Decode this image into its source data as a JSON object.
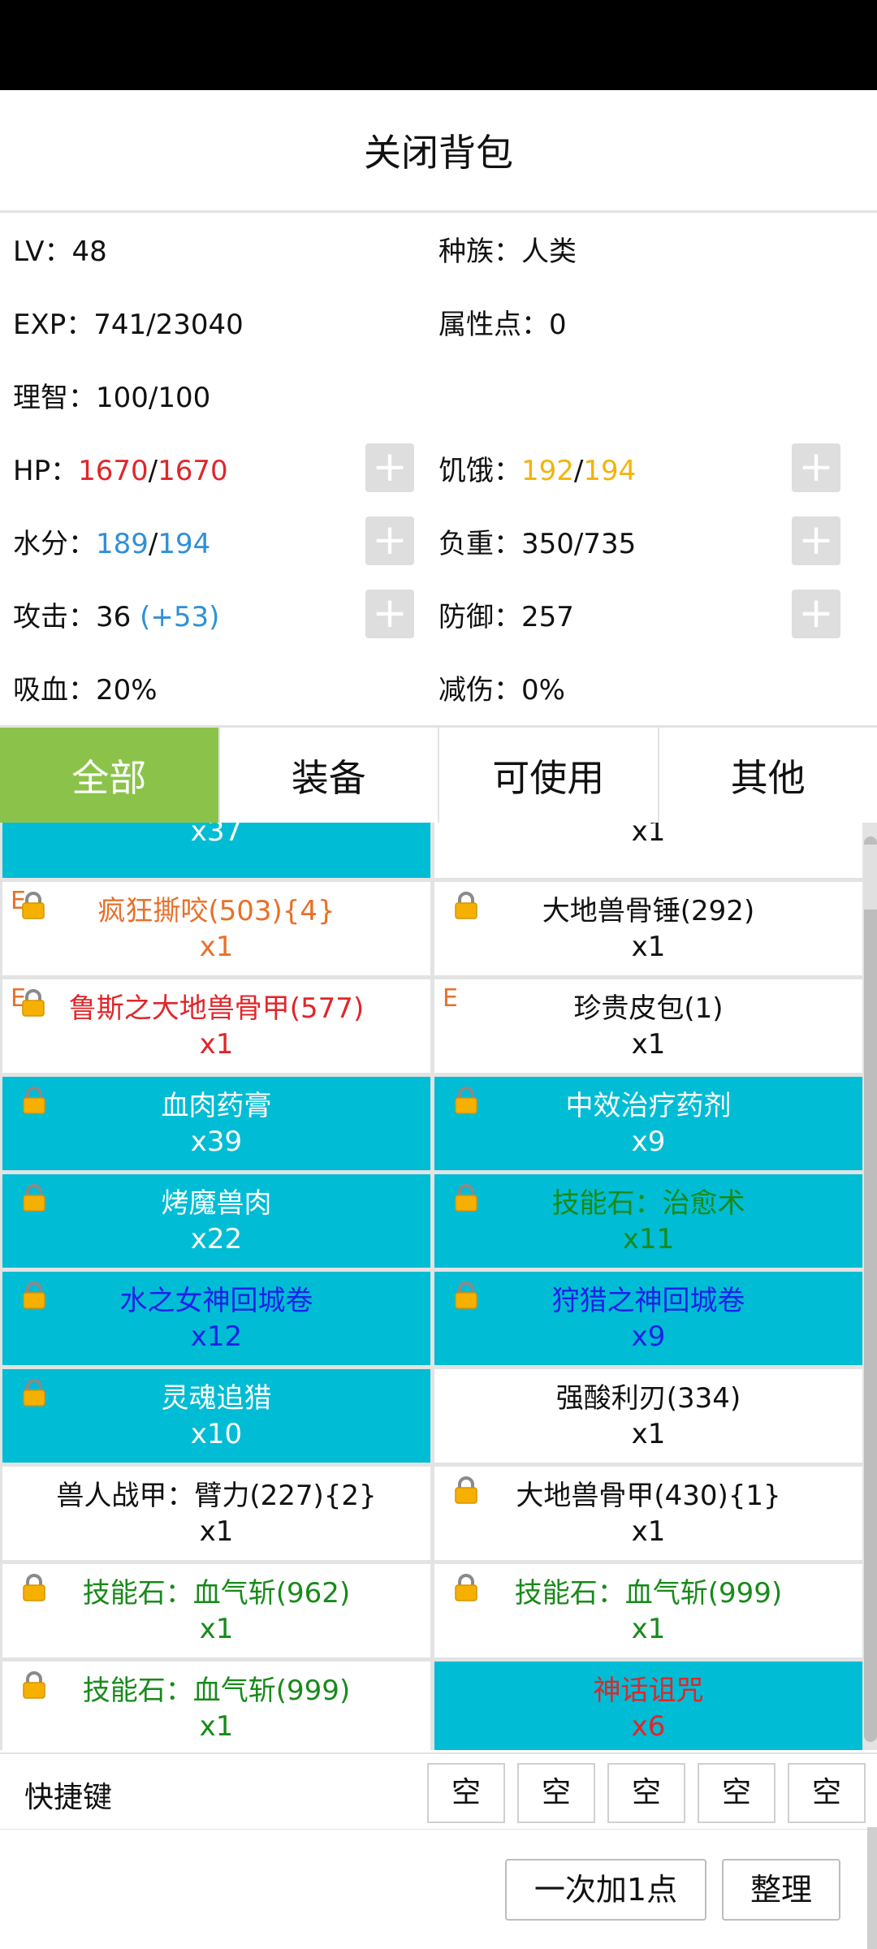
{
  "header": {
    "title": "关闭背包"
  },
  "stats": {
    "lv_label": "LV：",
    "lv_value": "48",
    "race_label": "种族：",
    "race_value": "人类",
    "exp_label": "EXP：",
    "exp_value": "741/23040",
    "attr_label": "属性点：",
    "attr_value": "0",
    "sanity_label": "理智：",
    "sanity_value": "100/100",
    "hp_label": "HP：",
    "hp_cur": "1670",
    "hp_sep": "/",
    "hp_max": "1670",
    "hunger_label": "饥饿：",
    "hunger_cur": "192",
    "hunger_sep": "/",
    "hunger_max": "194",
    "water_label": "水分：",
    "water_cur": "189",
    "water_sep": "/",
    "water_max": "194",
    "load_label": "负重：",
    "load_value": "350/735",
    "atk_label": "攻击：",
    "atk_value": "36",
    "atk_bonus": "(+53)",
    "def_label": "防御：",
    "def_value": "257",
    "lifesteal_label": "吸血：",
    "lifesteal_value": "20%",
    "dmgred_label": "减伤：",
    "dmgred_value": "0%",
    "plus_symbol": "+"
  },
  "tabs": [
    "全部",
    "装备",
    "可使用",
    "其他"
  ],
  "items": [
    {
      "name": "",
      "qty": "x37",
      "color": "white",
      "bg": "cyan",
      "lock": false,
      "e": false
    },
    {
      "name": "",
      "qty": "x1",
      "color": "black",
      "bg": "white",
      "lock": false,
      "e": false
    },
    {
      "name": "疯狂撕咬(503){4}",
      "qty": "x1",
      "color": "orange",
      "bg": "white",
      "lock": true,
      "e": true
    },
    {
      "name": "大地兽骨锤(292)",
      "qty": "x1",
      "color": "black",
      "bg": "white",
      "lock": true,
      "e": false
    },
    {
      "name": "鲁斯之大地兽骨甲(577)",
      "qty": "x1",
      "color": "red",
      "bg": "white",
      "lock": true,
      "e": true
    },
    {
      "name": "珍贵皮包(1)",
      "qty": "x1",
      "color": "black",
      "bg": "white",
      "lock": false,
      "e": true
    },
    {
      "name": "血肉药膏",
      "qty": "x39",
      "color": "white",
      "bg": "cyan",
      "lock": true,
      "e": false
    },
    {
      "name": "中效治疗药剂",
      "qty": "x9",
      "color": "white",
      "bg": "cyan",
      "lock": true,
      "e": false
    },
    {
      "name": "烤魔兽肉",
      "qty": "x22",
      "color": "white",
      "bg": "cyan",
      "lock": true,
      "e": false
    },
    {
      "name": "技能石：治愈术",
      "qty": "x11",
      "color": "green",
      "bg": "cyan",
      "lock": true,
      "e": false
    },
    {
      "name": "水之女神回城卷",
      "qty": "x12",
      "color": "navy",
      "bg": "cyan",
      "lock": true,
      "e": false
    },
    {
      "name": "狩猎之神回城卷",
      "qty": "x9",
      "color": "navy",
      "bg": "cyan",
      "lock": true,
      "e": false
    },
    {
      "name": "灵魂追猎",
      "qty": "x10",
      "color": "white",
      "bg": "cyan",
      "lock": true,
      "e": false
    },
    {
      "name": "强酸利刃(334)",
      "qty": "x1",
      "color": "black",
      "bg": "white",
      "lock": false,
      "e": false
    },
    {
      "name": "兽人战甲：臂力(227){2}",
      "qty": "x1",
      "color": "black",
      "bg": "white",
      "lock": false,
      "e": false
    },
    {
      "name": "大地兽骨甲(430){1}",
      "qty": "x1",
      "color": "black",
      "bg": "white",
      "lock": true,
      "e": false
    },
    {
      "name": "技能石：血气斩(962)",
      "qty": "x1",
      "color": "green",
      "bg": "white",
      "lock": true,
      "e": false
    },
    {
      "name": "技能石：血气斩(999)",
      "qty": "x1",
      "color": "green",
      "bg": "white",
      "lock": true,
      "e": false
    },
    {
      "name": "技能石：血气斩(999)",
      "qty": "x1",
      "color": "green",
      "bg": "white",
      "lock": true,
      "e": false
    },
    {
      "name": "神话诅咒",
      "qty": "x6",
      "color": "red",
      "bg": "cyan",
      "lock": false,
      "e": false
    }
  ],
  "e_mark": "E",
  "shortcut": {
    "label": "快捷键",
    "slots": [
      "空",
      "空",
      "空",
      "空",
      "空"
    ]
  },
  "buttons": {
    "add_one": "一次加1点",
    "sort": "整理"
  },
  "colors": {
    "accent": "#8bc34a",
    "cyan": "#00bcd4",
    "hp": "#e0262a",
    "water": "#2f90d8",
    "hunger": "#f2b40b"
  }
}
